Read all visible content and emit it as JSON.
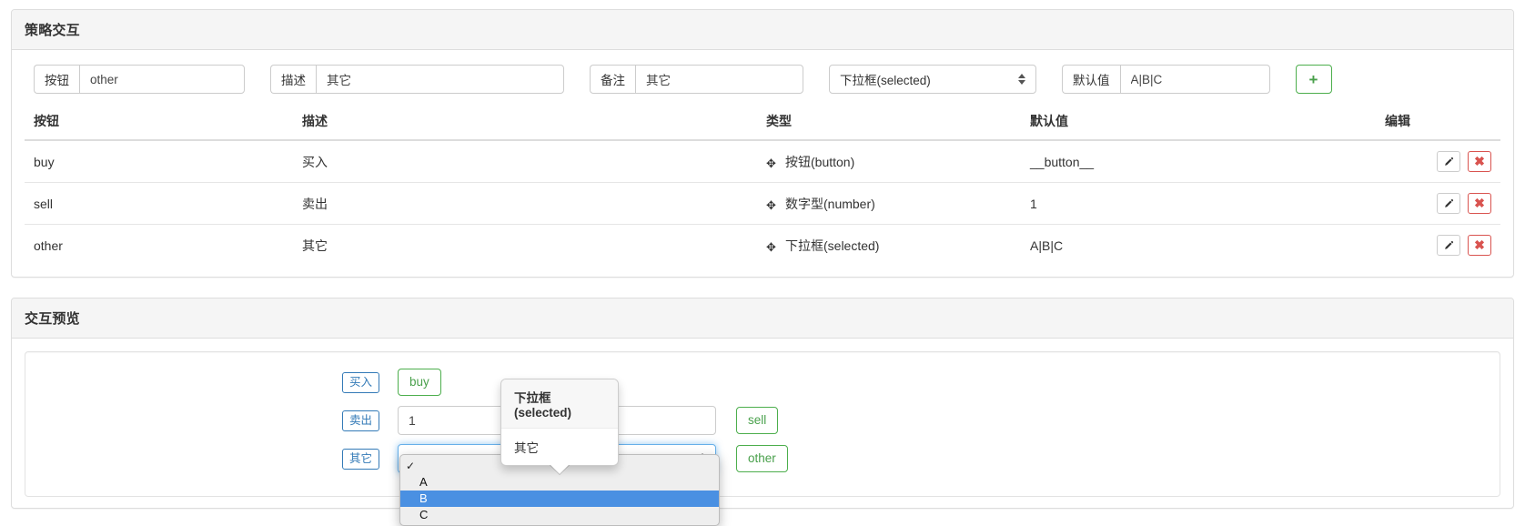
{
  "strategy_panel": {
    "title": "策略交互",
    "form": {
      "button_label": "按钮",
      "button_value": "other",
      "desc_label": "描述",
      "desc_value": "其它",
      "note_label": "备注",
      "note_value": "其它",
      "type_selected": "下拉框(selected)",
      "default_label": "默认值",
      "default_value": "A|B|C",
      "add_label": "+"
    },
    "table": {
      "headers": [
        "按钮",
        "描述",
        "类型",
        "默认值",
        "编辑"
      ],
      "rows": [
        {
          "button": "buy",
          "desc": "买入",
          "type": "按钮(button)",
          "default": "__button__"
        },
        {
          "button": "sell",
          "desc": "卖出",
          "type": "数字型(number)",
          "default": "1"
        },
        {
          "button": "other",
          "desc": "其它",
          "type": "下拉框(selected)",
          "default": "A|B|C"
        }
      ],
      "edit_icon": "pencil-icon",
      "delete_icon": "times-icon",
      "delete_glyph": "✖",
      "drag_glyph": "✥"
    }
  },
  "preview_panel": {
    "title": "交互预览",
    "rows": [
      {
        "label": "买入",
        "button": "buy"
      },
      {
        "label": "卖出",
        "input_value": "1",
        "button": "sell"
      },
      {
        "label": "其它",
        "select_value": "",
        "button": "other"
      }
    ],
    "popover": {
      "title": "下拉框(selected)",
      "content": "其它"
    },
    "options": {
      "blank_checkmark": "✓",
      "items": [
        "A",
        "B",
        "C"
      ],
      "highlighted": "B"
    }
  },
  "colors": {
    "accent_blue": "#337ab7",
    "green": "#4cae4c",
    "danger_red": "#d9534f",
    "option_highlight": "#4a90e2",
    "panel_header_bg": "#f5f5f5",
    "border": "#dddddd"
  }
}
